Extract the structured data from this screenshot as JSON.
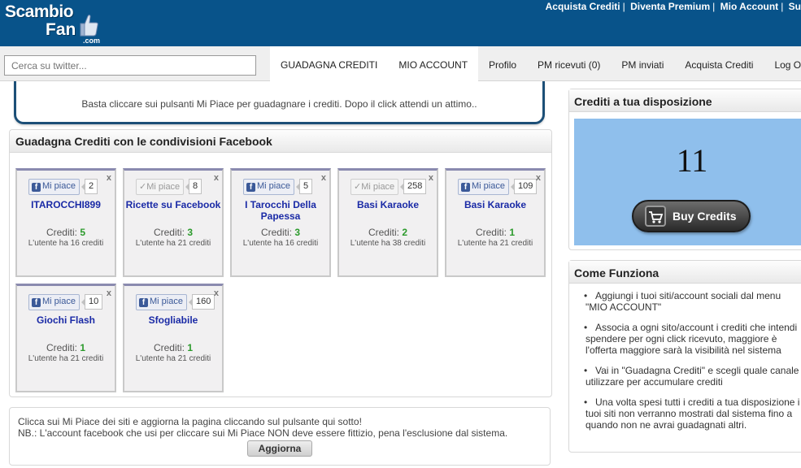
{
  "header": {
    "logo_line1": "Scambio",
    "logo_line2": "Fan",
    "logo_domain": ".com",
    "links": [
      "Acquista Crediti",
      "Diventa Premium",
      "Mio Account",
      "Su"
    ]
  },
  "search": {
    "placeholder": "Cerca su twitter..."
  },
  "nav": {
    "tabs": [
      {
        "label": "GUADAGNA CREDITI",
        "active": true
      },
      {
        "label": "MIO ACCOUNT",
        "active": true
      },
      {
        "label": "Profilo",
        "active": false
      },
      {
        "label": "PM ricevuti (0)",
        "active": false
      },
      {
        "label": "PM inviati",
        "active": false
      },
      {
        "label": "Acquista Crediti",
        "active": false
      },
      {
        "label": "Log Out",
        "active": false
      }
    ]
  },
  "intro": {
    "text": "Basta cliccare sui pulsanti Mi Piace per guadagnare i crediti. Dopo il click attendi un attimo.."
  },
  "facebook_panel": {
    "title": "Guadagna Crediti con le condivisioni Facebook",
    "like_label": "Mi piace",
    "credits_label": "Crediti:",
    "close_label": "x",
    "cards": [
      {
        "title": "ITAROCCHI899",
        "count": "2",
        "credits": "5",
        "user_credits": "L'utente ha 16 crediti",
        "liked": false
      },
      {
        "title": "Ricette su Facebook",
        "count": "8",
        "credits": "3",
        "user_credits": "L'utente ha 21 crediti",
        "liked": true
      },
      {
        "title": "I Tarocchi Della Papessa",
        "count": "5",
        "credits": "3",
        "user_credits": "L'utente ha 16 crediti",
        "liked": false
      },
      {
        "title": "Basi Karaoke",
        "count": "258",
        "credits": "2",
        "user_credits": "L'utente ha 38 crediti",
        "liked": true
      },
      {
        "title": "Basi Karaoke",
        "count": "109",
        "credits": "1",
        "user_credits": "L'utente ha 21 crediti",
        "liked": false
      },
      {
        "title": "Giochi Flash",
        "count": "10",
        "credits": "1",
        "user_credits": "L'utente ha 21 crediti",
        "liked": false
      },
      {
        "title": "Sfogliabile",
        "count": "160",
        "credits": "1",
        "user_credits": "L'utente ha 21 crediti",
        "liked": false
      }
    ]
  },
  "bottom_notice": {
    "line1": "Clicca sui Mi Piace dei siti e aggiorna la pagina cliccando sul pulsante qui sotto!",
    "line2": "NB.: L'account facebook che usi per cliccare sui Mi Piace NON deve essere fittizio, pena l'esclusione dal sistema.",
    "button": "Aggiorna"
  },
  "credits_panel": {
    "title": "Crediti a tua disposizione",
    "amount": "11",
    "buy_label": "Buy Credits"
  },
  "how_panel": {
    "title": "Come Funziona",
    "steps": [
      "Aggiungi i tuoi siti/account sociali dal menu \"MIO ACCOUNT\"",
      "Associa a ogni sito/account i crediti che intendi spendere per ogni click ricevuto, maggiore è l'offerta maggiore sarà la visibilità nel sistema",
      "Vai in \"Guadagna Crediti\" e scegli quale canale utilizzare per accumulare crediti",
      "Una volta spesi tutti i crediti a tua disposizione i tuoi siti non verranno mostrati dal sistema fino a quando non ne avrai guadagnati altri."
    ]
  },
  "colors": {
    "header_bg": "#08538a",
    "link_title": "#1a2aa6",
    "credits_green": "#2b9a2b",
    "credits_box": "#8fbfec",
    "facebook_blue": "#3b5998"
  }
}
